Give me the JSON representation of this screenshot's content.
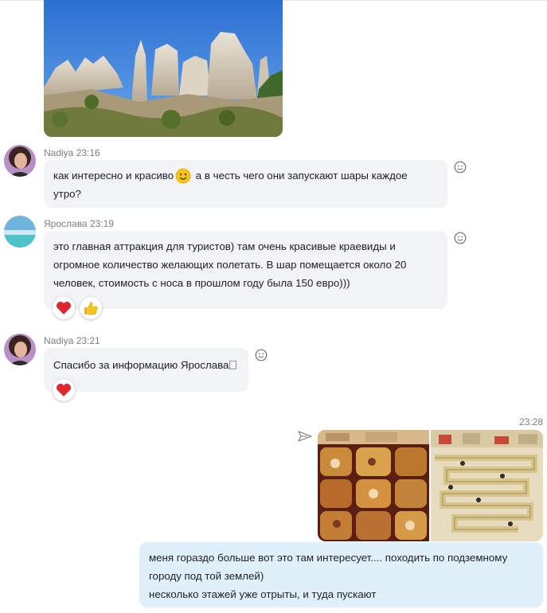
{
  "messages": [
    {
      "author": "Nadiya",
      "time": "23:16",
      "text_before_emoji": "как интересно и красиво",
      "text_after_emoji": " а в честь чего они запускают шары каждое утро?"
    },
    {
      "author": "Ярослава",
      "time": "23:19",
      "lines": [
        "это главная аттракция для туристов) там очень красивые краевиды и",
        "огромное количество желающих полетать.  В шар помещается около 20",
        "человек, стоимость с носа в прошлом году была 150 евро)))"
      ]
    },
    {
      "author": "Nadiya",
      "time": "23:21",
      "text": "Спасибо за информацию Ярослава"
    },
    {
      "author": "me",
      "time": "23:28",
      "lines": [
        "меня гораздо больше вот это там интересует.... походить по подземному",
        "городу под той землей)",
        "несколько этажей уже отрыты, и туда пускают"
      ]
    }
  ],
  "icons": {
    "add_reaction": "smiley-outline-icon",
    "heart": "heart-icon",
    "thumbs_up": "thumbs-up-icon",
    "send_state": "paper-plane-icon"
  },
  "colors": {
    "incoming_bubble": "#f1f3f5",
    "outgoing_bubble": "#dff0fb",
    "meta_text": "#7d7d7d",
    "heart": "#e0262f"
  }
}
